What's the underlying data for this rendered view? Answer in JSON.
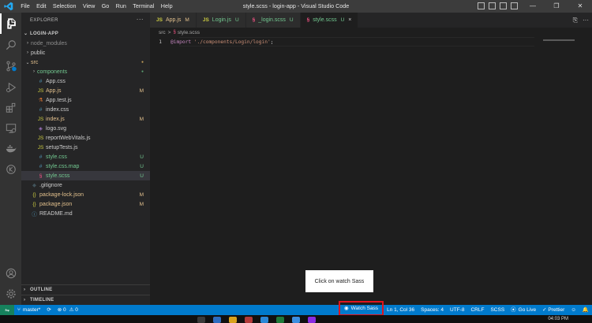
{
  "titlebar": {
    "menu": [
      "File",
      "Edit",
      "Selection",
      "View",
      "Go",
      "Run",
      "Terminal",
      "Help"
    ],
    "title": "style.scss - login-app - Visual Studio Code",
    "controls": [
      "—",
      "❐",
      "✕"
    ]
  },
  "activitybar": {
    "items": [
      "explorer-icon",
      "search-icon",
      "source-control-icon",
      "run-debug-icon",
      "extensions-icon",
      "remote-explorer-icon",
      "docker-icon",
      "timeline-icon"
    ],
    "bottom": [
      "account-icon",
      "settings-gear-icon"
    ]
  },
  "sidebar": {
    "header": "EXPLORER",
    "more": "···",
    "root": "LOGIN-APP",
    "tree": [
      {
        "label": "node_modules",
        "depth": 1,
        "kind": "folder",
        "collapsed": true,
        "color": "#8c8c8c",
        "badge": "",
        "badge_color": ""
      },
      {
        "label": "public",
        "depth": 1,
        "kind": "folder",
        "collapsed": true,
        "color": "#cccccc",
        "badge": "",
        "badge_color": ""
      },
      {
        "label": "src",
        "depth": 1,
        "kind": "folder",
        "collapsed": false,
        "color": "#e2c08d",
        "badge": "●",
        "badge_color": "#c5a05a"
      },
      {
        "label": "components",
        "depth": 2,
        "kind": "folder",
        "collapsed": true,
        "color": "#73c991",
        "badge": "●",
        "badge_color": "#5a9e6f"
      },
      {
        "label": "App.css",
        "depth": 2,
        "kind": "css",
        "color": "#cccccc",
        "badge": "",
        "badge_color": ""
      },
      {
        "label": "App.js",
        "depth": 2,
        "kind": "js",
        "color": "#e2c08d",
        "badge": "M",
        "badge_color": "#e2c08d"
      },
      {
        "label": "App.test.js",
        "depth": 2,
        "kind": "test",
        "color": "#cccccc",
        "badge": "",
        "badge_color": ""
      },
      {
        "label": "index.css",
        "depth": 2,
        "kind": "css",
        "color": "#cccccc",
        "badge": "",
        "badge_color": ""
      },
      {
        "label": "index.js",
        "depth": 2,
        "kind": "js",
        "color": "#e2c08d",
        "badge": "M",
        "badge_color": "#e2c08d"
      },
      {
        "label": "logo.svg",
        "depth": 2,
        "kind": "svg",
        "color": "#cccccc",
        "badge": "",
        "badge_color": ""
      },
      {
        "label": "reportWebVitals.js",
        "depth": 2,
        "kind": "js",
        "color": "#cccccc",
        "badge": "",
        "badge_color": ""
      },
      {
        "label": "setupTests.js",
        "depth": 2,
        "kind": "js",
        "color": "#cccccc",
        "badge": "",
        "badge_color": ""
      },
      {
        "label": "style.css",
        "depth": 2,
        "kind": "css",
        "color": "#73c991",
        "badge": "U",
        "badge_color": "#73c991"
      },
      {
        "label": "style.css.map",
        "depth": 2,
        "kind": "map",
        "color": "#73c991",
        "badge": "U",
        "badge_color": "#73c991"
      },
      {
        "label": "style.scss",
        "depth": 2,
        "kind": "scss",
        "color": "#73c991",
        "badge": "U",
        "badge_color": "#73c991",
        "selected": true
      },
      {
        "label": ".gitignore",
        "depth": 1,
        "kind": "git",
        "color": "#cccccc",
        "badge": "",
        "badge_color": ""
      },
      {
        "label": "package-lock.json",
        "depth": 1,
        "kind": "json",
        "color": "#e2c08d",
        "badge": "M",
        "badge_color": "#e2c08d"
      },
      {
        "label": "package.json",
        "depth": 1,
        "kind": "json",
        "color": "#e2c08d",
        "badge": "M",
        "badge_color": "#e2c08d"
      },
      {
        "label": "README.md",
        "depth": 1,
        "kind": "info",
        "color": "#cccccc",
        "badge": "",
        "badge_color": ""
      }
    ],
    "outline": "OUTLINE",
    "timeline": "TIMELINE"
  },
  "editor": {
    "tabs": [
      {
        "label": "App.js",
        "icon": "JS",
        "icon_color": "#cbcb41",
        "status": "M",
        "status_color": "#e2c08d",
        "label_color": "#e2c08d",
        "active": false
      },
      {
        "label": "Login.js",
        "icon": "JS",
        "icon_color": "#cbcb41",
        "status": "U",
        "status_color": "#73c991",
        "label_color": "#73c991",
        "active": false
      },
      {
        "label": "_login.scss",
        "icon": "§",
        "icon_color": "#f55385",
        "status": "U",
        "status_color": "#73c991",
        "label_color": "#73c991",
        "active": false
      },
      {
        "label": "style.scss",
        "icon": "§",
        "icon_color": "#f55385",
        "status": "U",
        "status_color": "#73c991",
        "label_color": "#73c991",
        "active": true,
        "close": "×"
      }
    ],
    "tab_actions": [
      "⎘",
      "···"
    ],
    "breadcrumb": {
      "folder": "src",
      "separator": ">",
      "file": "style.scss"
    },
    "lines": [
      {
        "num": "1",
        "keyword": "@import",
        "string": "'./components/Login/login'",
        "punct": ";"
      }
    ]
  },
  "tooltip": {
    "text": "Click on watch Sass"
  },
  "statusbar": {
    "remote_icon": "⇋",
    "branch": "master*",
    "sync": "⟳",
    "errors": "⊗ 0",
    "warnings": "⚠ 0",
    "watch_sass": "Watch Sass",
    "position": "Ln 1, Col 36",
    "spaces": "Spaces: 4",
    "encoding": "UTF-8",
    "eol": "CRLF",
    "language": "SCSS",
    "go_live": "Go Live",
    "prettier": "✓ Prettier",
    "feedback": "☺",
    "notifications": "🔔"
  },
  "taskbar": {
    "clock": "04:03 PM"
  },
  "colors": {
    "accent": "#007acc",
    "highlight": "#e0141e"
  }
}
